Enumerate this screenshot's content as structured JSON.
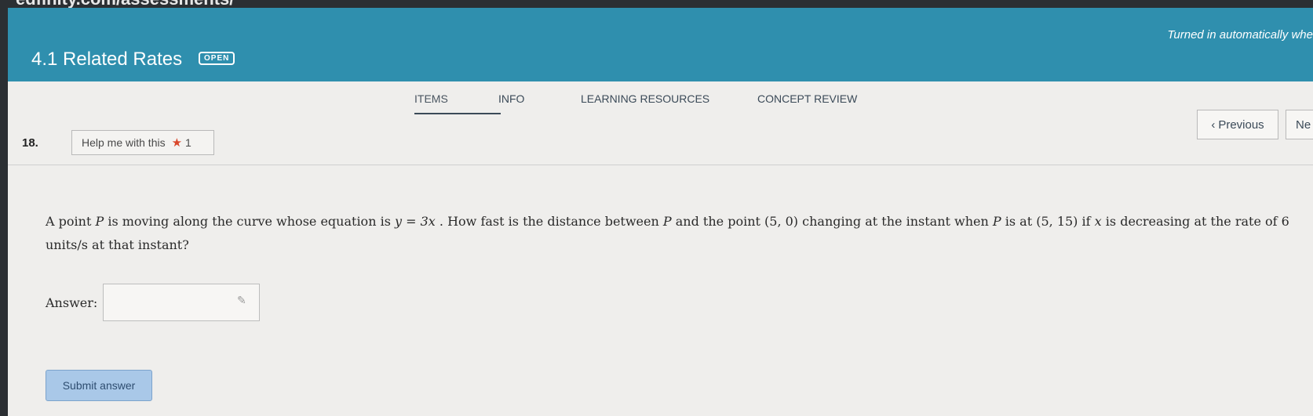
{
  "browser": {
    "url_fragment": "edfinity.com/assessments/"
  },
  "header": {
    "title": "4.1 Related Rates",
    "badge": "OPEN",
    "due_note": "Turned in automatically whe"
  },
  "tabs": [
    {
      "label": "ITEMS"
    },
    {
      "label": "INFO"
    },
    {
      "label": "LEARNING RESOURCES"
    },
    {
      "label": "CONCEPT REVIEW"
    }
  ],
  "item": {
    "number": "18.",
    "help_label": "Help me with this",
    "help_count": "1",
    "prev_label": "Previous",
    "next_label": "Ne"
  },
  "question": {
    "p1": "A point",
    "v_P": "P",
    "p2": "is moving along the curve whose equation is",
    "eq": "y = 3x",
    "p3": ". How fast is the distance between",
    "p4": "and the point",
    "pt1": "(5, 0)",
    "p5": "changing at the instant when",
    "p6": "is at",
    "pt2": "(5, 15)",
    "p7": "if",
    "v_x": "x",
    "p8": "is decreasing at the rate of",
    "rate": "6",
    "p9": "units/s at that instant?"
  },
  "answer": {
    "label": "Answer:",
    "value": ""
  },
  "submit_label": "Submit answer",
  "icons": {
    "star": "star-icon",
    "chevron": "chevron-left-icon",
    "pencil": "pencil-icon"
  },
  "colors": {
    "header": "#2f8fae",
    "star": "#d9472b",
    "submit": "#a9c8e8"
  }
}
